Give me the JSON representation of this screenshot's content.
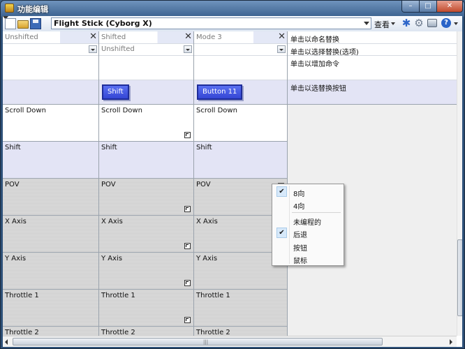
{
  "window": {
    "title": "功能编辑",
    "minimize": "–",
    "maximize": "□",
    "close": "✕"
  },
  "toolbar": {
    "profile": "Flight Stick (Cyborg X)",
    "view_label": "查看",
    "help_glyph": "?",
    "asterisk_glyph": "✱",
    "gear_glyph": "⚙"
  },
  "columns": [
    {
      "header": "Unshifted",
      "sel": "",
      "button": ""
    },
    {
      "header": "Shifted",
      "sel": "Unshifted",
      "button": "Shift"
    },
    {
      "header": "Mode 3",
      "sel": "",
      "button": "Button 11"
    }
  ],
  "rows": [
    {
      "labels": [
        "Scroll Down",
        "Scroll Down",
        "Scroll Down"
      ],
      "style": "white"
    },
    {
      "labels": [
        "Shift",
        "Shift",
        "Shift"
      ],
      "style": "lav"
    },
    {
      "labels": [
        "POV",
        "POV",
        "POV"
      ],
      "style": "gray"
    },
    {
      "labels": [
        "X Axis",
        "X Axis",
        "X Axis"
      ],
      "style": "gray"
    },
    {
      "labels": [
        "Y Axis",
        "Y Axis",
        "Y Axis"
      ],
      "style": "gray"
    },
    {
      "labels": [
        "Throttle 1",
        "Throttle 1",
        "Throttle 1"
      ],
      "style": "gray"
    },
    {
      "labels": [
        "Throttle 2",
        "Throttle 2",
        "Throttle 2"
      ],
      "style": "gray"
    }
  ],
  "right_panel": {
    "rename": "单击以命名替换",
    "select": "单击以选择替换(选项)",
    "add_command": "单击以增加命令",
    "select_button": "单击以选替换按钮"
  },
  "context_menu": {
    "items": [
      {
        "label": "8向",
        "checked": true
      },
      {
        "label": "4向",
        "checked": false
      },
      {
        "label": "未编程的",
        "checked": false
      },
      {
        "label": "后退",
        "checked": true
      },
      {
        "label": "按钮",
        "checked": false
      },
      {
        "label": "鼠标",
        "checked": false
      }
    ],
    "check_glyph": "✔"
  },
  "scroll_grip": "|||"
}
